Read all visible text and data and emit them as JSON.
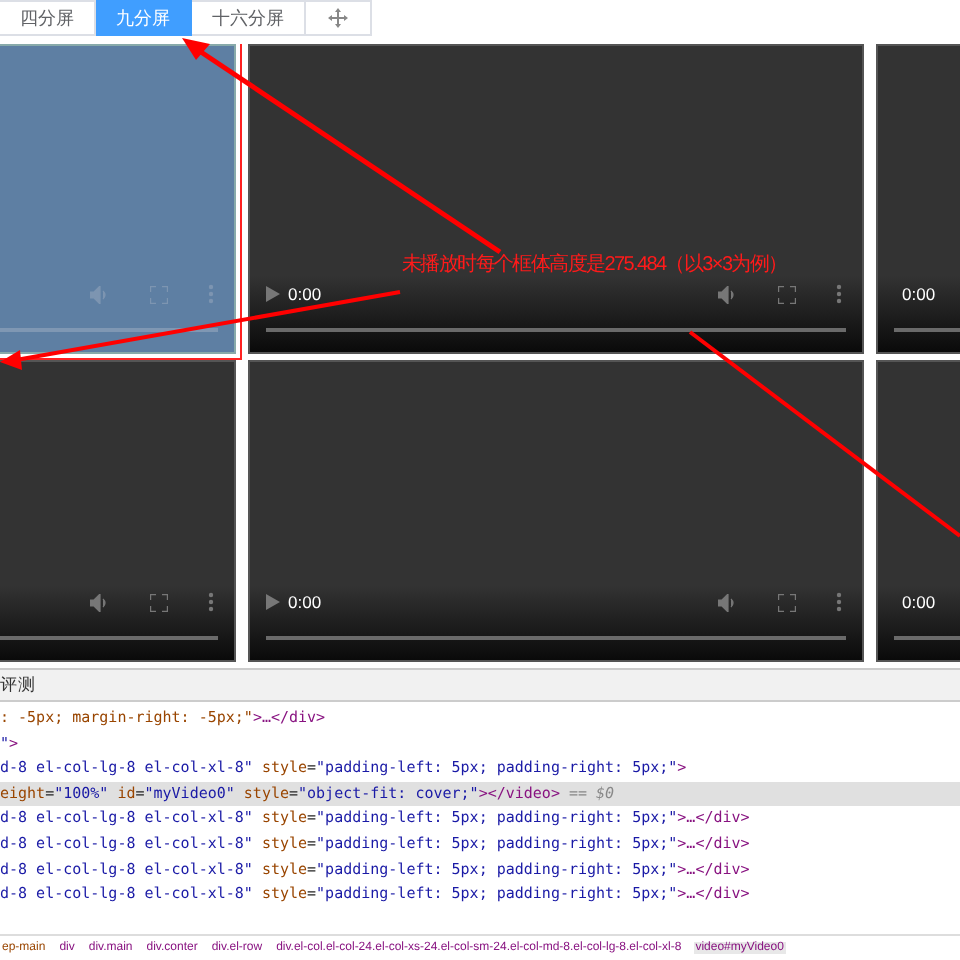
{
  "tabs": [
    {
      "kind": "text",
      "label": "四分屏",
      "selected": false
    },
    {
      "kind": "text",
      "label": "九分屏",
      "selected": true
    },
    {
      "kind": "text",
      "label": "十六分屏",
      "selected": false
    },
    {
      "kind": "move",
      "selected": false
    }
  ],
  "videos": [
    {
      "highlighted": true
    },
    {
      "highlighted": false,
      "time": "0:00"
    },
    {
      "highlighted": false,
      "time": "0:00"
    },
    {
      "highlighted": false
    },
    {
      "highlighted": false,
      "time": "0:00"
    },
    {
      "highlighted": false,
      "time": "0:00"
    }
  ],
  "annotation": {
    "text": "未播放时每个框体高度是275.484（以3×3为例）"
  },
  "devtools": {
    "tab": "评测",
    "lines": [
      {
        "selected": false,
        "segments": [
          {
            "kind": "attr",
            "text": ": -5px; margin-right: -5px;\""
          },
          {
            "kind": "tag",
            "text": ">…</div>"
          }
        ]
      },
      {
        "selected": false,
        "segments": [
          {
            "kind": "value",
            "text": "\""
          },
          {
            "kind": "tag",
            "text": ">"
          }
        ]
      },
      {
        "selected": false,
        "segments": [
          {
            "kind": "value",
            "text": "d-8 el-col-lg-8 el-col-xl-8\""
          },
          {
            "kind": "attr",
            "text": " style"
          },
          {
            "kind": "plain",
            "text": "="
          },
          {
            "kind": "value",
            "text": "\"padding-left: 5px; padding-right: 5px;\""
          },
          {
            "kind": "tag",
            "text": ">"
          }
        ]
      },
      {
        "selected": true,
        "segments": [
          {
            "kind": "attr",
            "text": "eight"
          },
          {
            "kind": "plain",
            "text": "="
          },
          {
            "kind": "value",
            "text": "\"100%\""
          },
          {
            "kind": "attr",
            "text": " id"
          },
          {
            "kind": "plain",
            "text": "="
          },
          {
            "kind": "value",
            "text": "\"myVideo0\""
          },
          {
            "kind": "attr",
            "text": " style"
          },
          {
            "kind": "plain",
            "text": "="
          },
          {
            "kind": "value",
            "text": "\"object-fit: cover;\""
          },
          {
            "kind": "tag",
            "text": "></video>"
          },
          {
            "kind": "dim",
            "text": " == $0"
          }
        ]
      },
      {
        "selected": false,
        "segments": [
          {
            "kind": "value",
            "text": "d-8 el-col-lg-8 el-col-xl-8\""
          },
          {
            "kind": "attr",
            "text": " style"
          },
          {
            "kind": "plain",
            "text": "="
          },
          {
            "kind": "value",
            "text": "\"padding-left: 5px; padding-right: 5px;\""
          },
          {
            "kind": "tag",
            "text": ">…</div>"
          }
        ]
      },
      {
        "selected": false,
        "segments": [
          {
            "kind": "value",
            "text": "d-8 el-col-lg-8 el-col-xl-8\""
          },
          {
            "kind": "attr",
            "text": " style"
          },
          {
            "kind": "plain",
            "text": "="
          },
          {
            "kind": "value",
            "text": "\"padding-left: 5px; padding-right: 5px;\""
          },
          {
            "kind": "tag",
            "text": ">…</div>"
          }
        ]
      },
      {
        "selected": false,
        "segments": [
          {
            "kind": "value",
            "text": "d-8 el-col-lg-8 el-col-xl-8\""
          },
          {
            "kind": "attr",
            "text": " style"
          },
          {
            "kind": "plain",
            "text": "="
          },
          {
            "kind": "value",
            "text": "\"padding-left: 5px; padding-right: 5px;\""
          },
          {
            "kind": "tag",
            "text": ">…</div>"
          }
        ]
      },
      {
        "selected": false,
        "segments": [
          {
            "kind": "value",
            "text": "d-8 el-col-lg-8 el-col-xl-8\""
          },
          {
            "kind": "attr",
            "text": " style"
          },
          {
            "kind": "plain",
            "text": "="
          },
          {
            "kind": "value",
            "text": "\"padding-left: 5px; padding-right: 5px;\""
          },
          {
            "kind": "tag",
            "text": ">…</div>"
          }
        ]
      }
    ],
    "breadcrumbs": [
      {
        "label": "ep-main",
        "selected": false
      },
      {
        "label": "div",
        "selected": false
      },
      {
        "label": "div.main",
        "selected": false
      },
      {
        "label": "div.conter",
        "selected": false
      },
      {
        "label": "div.el-row",
        "selected": false
      },
      {
        "label": "div.el-col.el-col-24.el-col-xs-24.el-col-sm-24.el-col-md-8.el-col-lg-8.el-col-xl-8",
        "selected": false
      },
      {
        "label": "video#myVideo0",
        "selected": true
      }
    ]
  }
}
